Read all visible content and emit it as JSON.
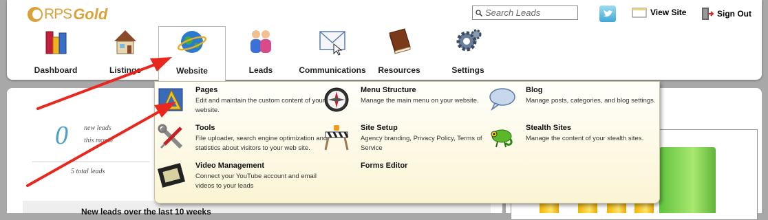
{
  "brand": {
    "rps": "RPS",
    "gold": "Gold"
  },
  "search": {
    "placeholder": "Search Leads"
  },
  "top_links": {
    "view_site": "View Site",
    "sign_out": "Sign Out"
  },
  "nav": {
    "items": [
      {
        "label": "Dashboard",
        "icon": "bar-chart-icon"
      },
      {
        "label": "Listings",
        "icon": "house-icon"
      },
      {
        "label": "Website",
        "icon": "globe-icon",
        "active": true
      },
      {
        "label": "Leads",
        "icon": "people-icon"
      },
      {
        "label": "Communications",
        "icon": "envelope-icon"
      },
      {
        "label": "Resources",
        "icon": "book-icon"
      },
      {
        "label": "Settings",
        "icon": "gears-icon"
      }
    ]
  },
  "dropdown": {
    "items": [
      {
        "title": "Pages",
        "desc": "Edit and maintain the custom content of your website.",
        "icon": "pencil-triangle-icon"
      },
      {
        "title": "Menu Structure",
        "desc": "Manage the main menu on your website.",
        "icon": "compass-icon"
      },
      {
        "title": "Blog",
        "desc": "Manage posts, categories, and blog settings.",
        "icon": "speech-bubble-icon"
      },
      {
        "title": "Tools",
        "desc": "File uploader, search engine optimization and statistics about visitors to your web site.",
        "icon": "wrench-screwdriver-icon"
      },
      {
        "title": "Site Setup",
        "desc": "Agency branding, Privacy Policy, Terms of Service",
        "icon": "barrier-icon"
      },
      {
        "title": "Stealth Sites",
        "desc": "Manage the content of your stealth sites.",
        "icon": "chameleon-icon"
      },
      {
        "title": "Video Management",
        "desc": "Connect your YouTube account and email videos to your leads",
        "icon": "film-strip-icon"
      },
      {
        "title": "Forms Editor",
        "desc": "",
        "icon": ""
      }
    ]
  },
  "stats": {
    "new_leads_count": "0",
    "new_leads_label_1": "new leads",
    "new_leads_label_2": "this month",
    "total_leads": "5 total leads"
  },
  "chart": {
    "title": "New leads over the last 10 weeks"
  },
  "colors": {
    "brand_gold": "#d9a23b",
    "accent_blue": "#4aa0c8",
    "arrow_red": "#e8281e",
    "menu_bg": "#fbf4d4"
  }
}
